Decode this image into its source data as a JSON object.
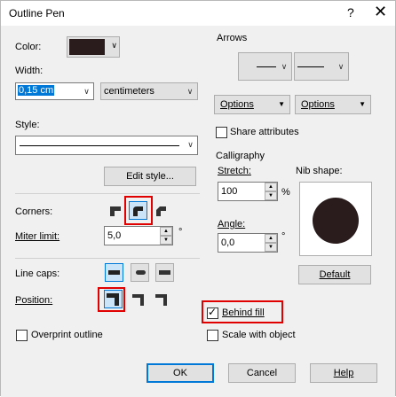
{
  "window": {
    "title": "Outline Pen",
    "help_glyph": "?",
    "close_glyph": "✕"
  },
  "color": {
    "label": "Color:",
    "swatch": "#2a1c1c"
  },
  "width": {
    "label": "Width:",
    "value": "0,15 cm",
    "units": "centimeters"
  },
  "style": {
    "label": "Style:",
    "edit_button": "Edit style..."
  },
  "corners": {
    "label": "Corners:"
  },
  "miter": {
    "label": "Miter limit:",
    "value": "5,0",
    "unit": "°"
  },
  "line_caps": {
    "label": "Line caps:"
  },
  "position": {
    "label": "Position:"
  },
  "overprint": {
    "label": "Overprint outline",
    "checked": false
  },
  "arrows": {
    "label": "Arrows",
    "options_left": "Options",
    "options_right": "Options",
    "share_label": "Share attributes"
  },
  "calligraphy": {
    "label": "Calligraphy",
    "stretch_label": "Stretch:",
    "stretch_value": "100",
    "stretch_unit": "%",
    "angle_label": "Angle:",
    "angle_value": "0,0",
    "angle_unit": "°",
    "nib_label": "Nib shape:",
    "default_button": "Default",
    "nib_color": "#2a1c1c"
  },
  "behind_fill": {
    "label": "Behind fill",
    "checked": true
  },
  "scale_with_object": {
    "label": "Scale with object",
    "checked": false
  },
  "buttons": {
    "ok": "OK",
    "cancel": "Cancel",
    "help": "Help"
  },
  "highlight_color": "#e00000",
  "accent_color": "#0078d7"
}
